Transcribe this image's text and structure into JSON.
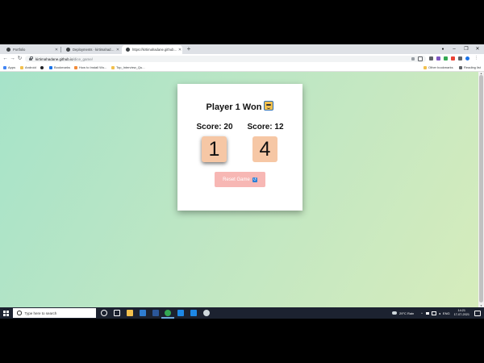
{
  "browser": {
    "tabs": [
      {
        "title": "Portfolio",
        "active": false
      },
      {
        "title": "Deployments · kirtimahadane/d...",
        "active": false
      },
      {
        "title": "https://kirtimahadane.github.io/...",
        "active": true
      }
    ],
    "new_tab": "+",
    "window_controls": {
      "minimize": "–",
      "maximize": "❐",
      "close": "✕"
    },
    "url": {
      "host": "kirtimahadane.github.io",
      "path": "/dice_game/"
    },
    "bookmarks": [
      {
        "label": "Apps",
        "color": "#4285f4"
      },
      {
        "label": "Android",
        "color": "#f2c04d"
      },
      {
        "label": "",
        "color": "#202124"
      },
      {
        "label": "Bookmarks",
        "color": "#1a73e8"
      },
      {
        "label": "How to Install Wo...",
        "color": "#f28b39"
      },
      {
        "label": "Top_Interview_Qu...",
        "color": "#f2c04d"
      }
    ],
    "other_bookmarks": "Other bookmarks",
    "reading_list": "Reading list"
  },
  "game": {
    "winner_text": "Player 1 Won",
    "player1": {
      "score_label": "Score: 20",
      "die": "1"
    },
    "player2": {
      "score_label": "Score: 12",
      "die": "4"
    },
    "reset_label": "Reset Game",
    "reset_icon": "↺"
  },
  "taskbar": {
    "search_placeholder": "Type here to search",
    "weather": "29°C  Rain",
    "language": "ENG",
    "time": "14:21",
    "date": "17-07-2021"
  },
  "colors": {
    "bg_gradient_start": "#a6e3c9",
    "bg_gradient_end": "#d6ecbc",
    "die_face": "#f6c7a5",
    "reset_button": "#f7b7b4",
    "taskbar": "#1c2230"
  }
}
